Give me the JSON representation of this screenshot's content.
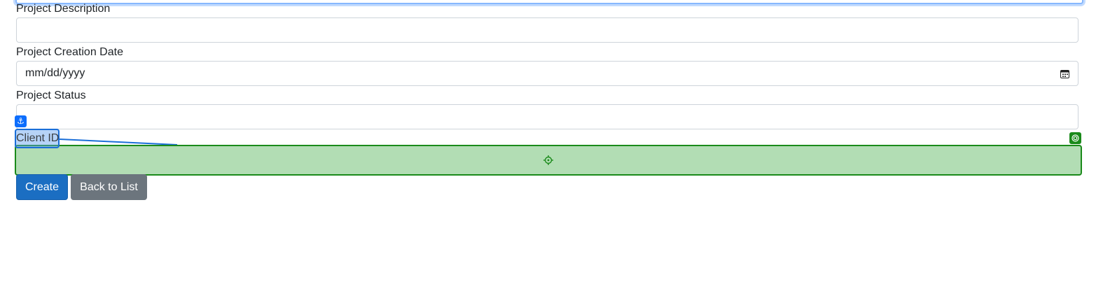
{
  "form": {
    "description_label": "Project Description",
    "description_value": "",
    "creation_date_label": "Project Creation Date",
    "creation_date_value": "mm/dd/yyyy",
    "status_label": "Project Status",
    "status_value": "",
    "client_id_label": "Client ID",
    "client_id_value": ""
  },
  "actions": {
    "create_label": "Create",
    "back_label": "Back to List"
  },
  "overlay": {
    "anchor_glyph": "⚓",
    "anchor_icon": "anchor-icon",
    "target_icon": "target-icon",
    "crosshair_icon": "crosshair-icon",
    "anchor_color": "#0d6efd",
    "target_color": "#1a8a1a",
    "target_fill": "#b2ddb4"
  },
  "colors": {
    "primary": "#1b6ec2",
    "secondary": "#6c757d",
    "border": "#ced4da"
  }
}
